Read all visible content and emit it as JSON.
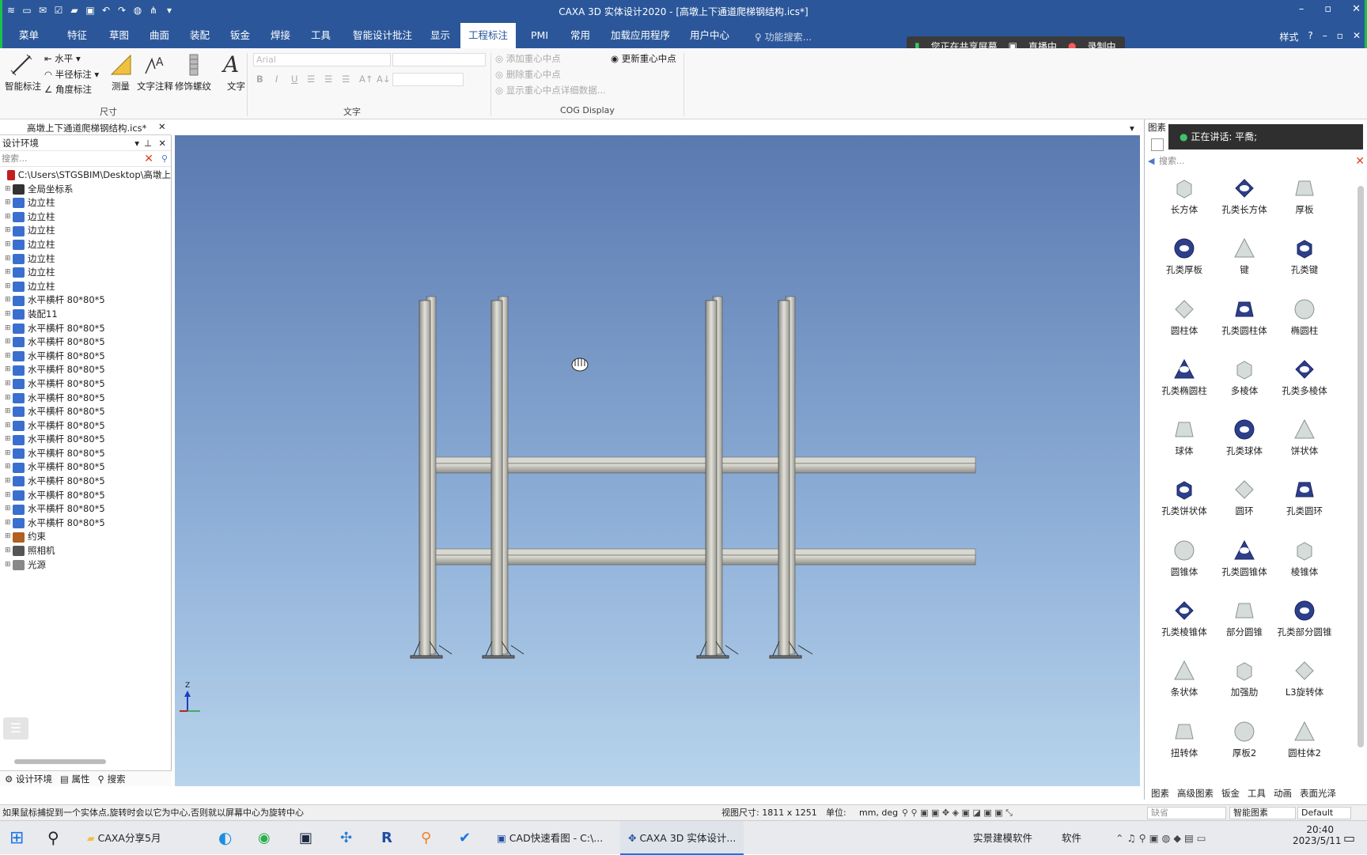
{
  "window": {
    "title": "CAXA 3D 实体设计2020 - [高墩上下通道爬梯钢结构.ics*]",
    "controls": [
      "–",
      "▫",
      "✕"
    ]
  },
  "menubar": {
    "tabs": [
      "菜单",
      "特征",
      "草图",
      "曲面",
      "装配",
      "钣金",
      "焊接",
      "工具",
      "智能设计批注",
      "显示",
      "工程标注",
      "PMI",
      "常用",
      "加载应用程序",
      "用户中心"
    ],
    "active_tab": "工程标注",
    "search_placeholder": "功能搜索...",
    "style_label": "样式",
    "help": "?"
  },
  "share_bar": {
    "sharing": "您正在共享屏幕",
    "live": "直播中",
    "recording": "录制中"
  },
  "ribbon": {
    "smart_dim": "智能标注",
    "horizontal": "水平",
    "radius_dim": "半径标注",
    "angle_dim": "角度标注",
    "measure": "测量",
    "text_annot": "文字注释",
    "thread": "修饰螺纹",
    "text": "文字",
    "font_value": "Arial",
    "group_dim": "尺寸",
    "group_text": "文字",
    "group_cog": "COG Display",
    "add_cog": "添加重心中点",
    "delete_cog": "删除重心中点",
    "show_cog": "显示重心中点详细数据...",
    "update_cog": "更新重心中点",
    "format_buttons": [
      "B",
      "I",
      "U"
    ]
  },
  "document_tab": "高墩上下通道爬梯钢结构.ics*",
  "left_panel": {
    "title": "设计环境",
    "search_placeholder": "搜索...",
    "tree": [
      {
        "label": "C:\\Users\\STGSBIM\\Desktop\\高墩上",
        "icon": "root-icon"
      },
      {
        "label": "全局坐标系",
        "icon": "axes-icon"
      },
      {
        "label": "边立柱",
        "icon": "part-icon"
      },
      {
        "label": "边立柱",
        "icon": "part-icon"
      },
      {
        "label": "边立柱",
        "icon": "part-icon"
      },
      {
        "label": "边立柱",
        "icon": "part-icon"
      },
      {
        "label": "边立柱",
        "icon": "part-icon"
      },
      {
        "label": "边立柱",
        "icon": "part-icon"
      },
      {
        "label": "边立柱",
        "icon": "part-icon"
      },
      {
        "label": "水平横杆 80*80*5",
        "icon": "part-icon"
      },
      {
        "label": "装配11",
        "icon": "assembly-icon"
      },
      {
        "label": "水平横杆 80*80*5",
        "icon": "part-icon"
      },
      {
        "label": "水平横杆 80*80*5",
        "icon": "part-icon"
      },
      {
        "label": "水平横杆 80*80*5",
        "icon": "part-icon"
      },
      {
        "label": "水平横杆 80*80*5",
        "icon": "part-icon"
      },
      {
        "label": "水平横杆 80*80*5",
        "icon": "part-icon"
      },
      {
        "label": "水平横杆 80*80*5",
        "icon": "part-icon"
      },
      {
        "label": "水平横杆 80*80*5",
        "icon": "part-icon"
      },
      {
        "label": "水平横杆 80*80*5",
        "icon": "part-icon"
      },
      {
        "label": "水平横杆 80*80*5",
        "icon": "part-icon"
      },
      {
        "label": "水平横杆 80*80*5",
        "icon": "part-icon"
      },
      {
        "label": "水平横杆 80*80*5",
        "icon": "part-icon"
      },
      {
        "label": "水平横杆 80*80*5",
        "icon": "part-icon"
      },
      {
        "label": "水平横杆 80*80*5",
        "icon": "part-icon"
      },
      {
        "label": "水平横杆 80*80*5",
        "icon": "part-icon"
      },
      {
        "label": "水平横杆 80*80*5",
        "icon": "part-icon"
      },
      {
        "label": "约束",
        "icon": "constraint-icon"
      },
      {
        "label": "照相机",
        "icon": "camera-icon"
      },
      {
        "label": "光源",
        "icon": "light-icon"
      }
    ],
    "bottom_tabs": [
      "设计环境",
      "属性",
      "搜索"
    ]
  },
  "right_panel": {
    "tab": "图素",
    "speaking": "正在讲话: 平喬;",
    "search_placeholder": "搜索...",
    "items": [
      "长方体",
      "孔类长方体",
      "厚板",
      "孔类厚板",
      "键",
      "孔类键",
      "圆柱体",
      "孔类圆柱体",
      "椭圆柱",
      "孔类椭圆柱",
      "多棱体",
      "孔类多棱体",
      "球体",
      "孔类球体",
      "饼状体",
      "孔类饼状体",
      "圆环",
      "孔类圆环",
      "圆锥体",
      "孔类圆锥体",
      "棱锥体",
      "孔类棱锥体",
      "部分圆锥",
      "孔类部分圆锥",
      "条状体",
      "加强肋",
      "L3旋转体",
      "扭转体",
      "厚板2",
      "圆柱体2"
    ],
    "bottom_tabs": [
      "图素",
      "高级图素",
      "钣金",
      "工具",
      "动画",
      "表面光泽"
    ]
  },
  "statusbar": {
    "hint": "如果鼠标捕捉到一个实体点,旋转时会以它为中心,否则就以屏幕中心为旋转中心",
    "view_size": "视图尺寸: 1811 x 1251",
    "unit_label": "单位:",
    "unit_value": "mm, deg",
    "mode": "智能图素",
    "mode2": "Default",
    "field": "缺省"
  },
  "taskbar": {
    "items": [
      "CAXA分享5月",
      "CAD快速看图 - C:\\...",
      "CAXA 3D 实体设计..."
    ],
    "tray_text": "实景建模软件",
    "tray_text2": "软件",
    "time": "20:40",
    "date": "2023/5/11"
  },
  "colors": {
    "ribbon_blue": "#2b579a",
    "viewport_top": "#5a79b0",
    "viewport_bottom": "#b8d4ec",
    "steel": "#c9c9c2"
  },
  "triad": {
    "z": "Z"
  }
}
